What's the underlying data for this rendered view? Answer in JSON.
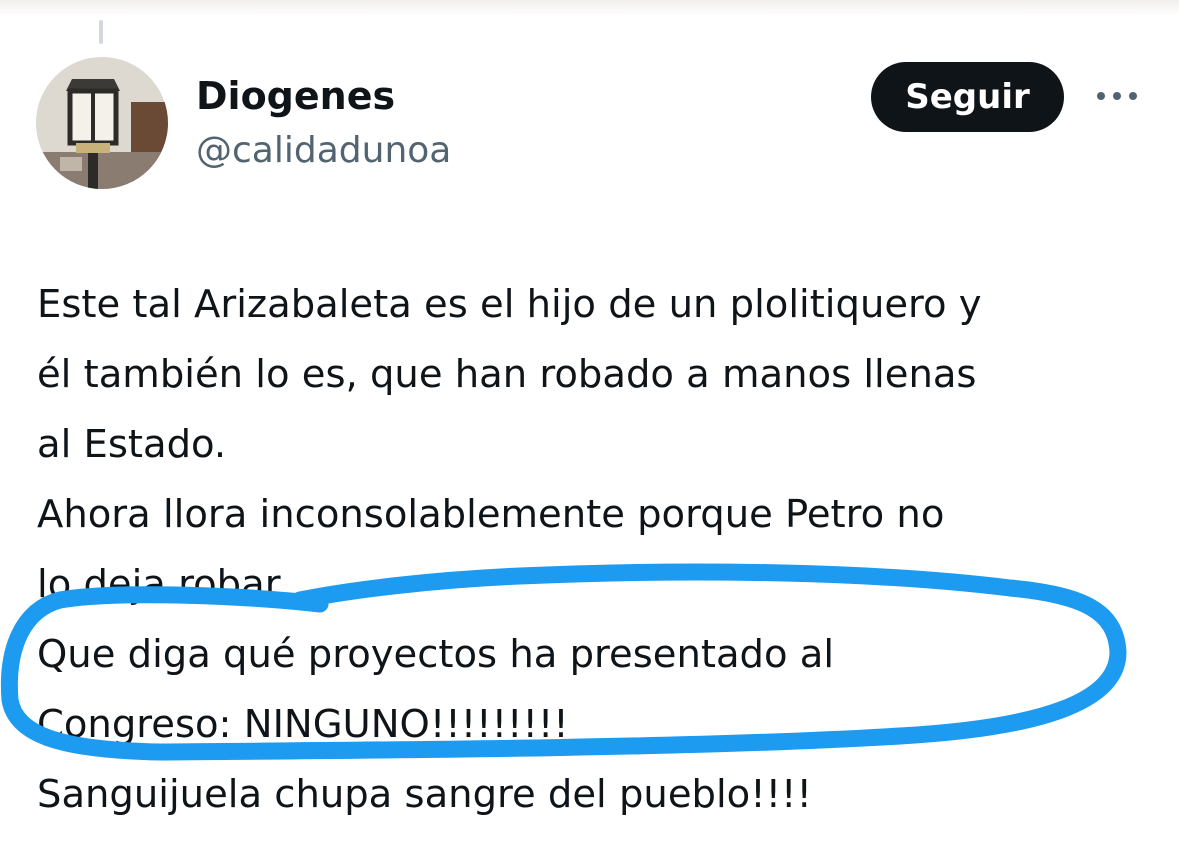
{
  "tweet": {
    "author": {
      "display_name": "Diogenes",
      "handle": "@calidadunoa"
    },
    "follow_label": "Seguir",
    "more_icon": "more-horizontal-icon",
    "lines": [
      "Este tal Arizabaleta es el hijo de un plolitiquero y",
      "él también lo es, que han robado a manos llenas",
      "al Estado.",
      "Ahora llora inconsolablemente porque Petro no",
      "lo deja robar.",
      "Que diga qué proyectos ha presentado al",
      "Congreso: NINGUNO!!!!!!!!!",
      "Sanguijuela chupa sangre del pueblo!!!!"
    ]
  },
  "annotation": {
    "color": "#1d9bf0"
  }
}
